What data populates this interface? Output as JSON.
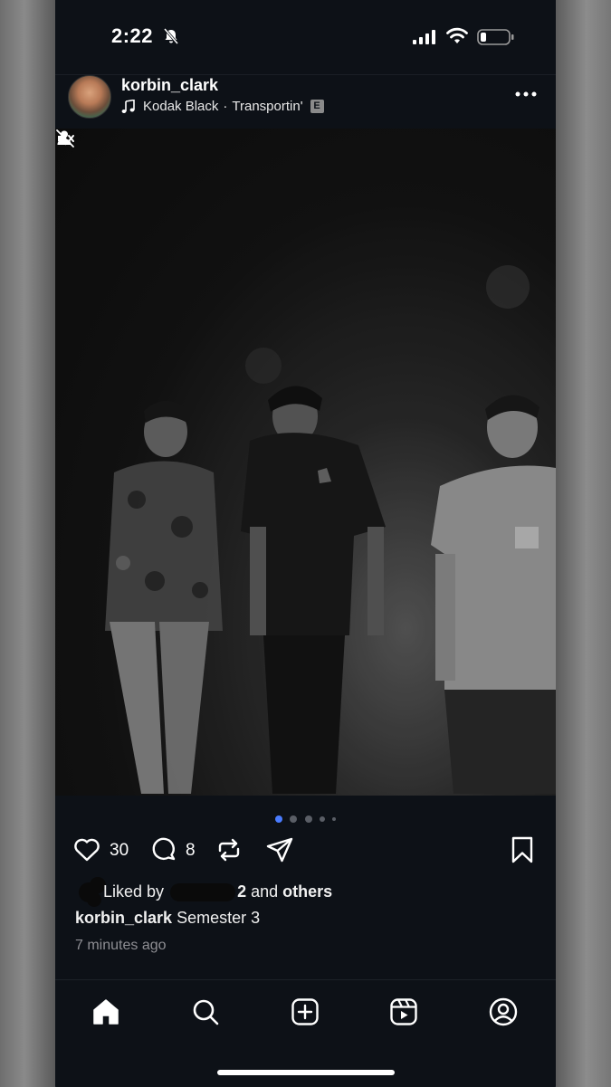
{
  "status_bar": {
    "time": "2:22",
    "icons": [
      "bell-slash-icon",
      "cellular-signal-icon",
      "wifi-icon",
      "battery-icon"
    ]
  },
  "post": {
    "username": "korbin_clark",
    "music": {
      "artist": "Kodak Black",
      "separator": "·",
      "song": "Transportin'",
      "explicit_badge": "E"
    },
    "photo_overlay_icons": [
      "user-tag-icon",
      "sound-off-icon"
    ],
    "carousel": {
      "total_dots": 5,
      "active_index": 0,
      "active_color": "#4a7cff"
    },
    "actions": {
      "likes_count": "30",
      "comments_count": "8"
    },
    "liked_by": {
      "prefix": "Liked by",
      "user_suffix": "2",
      "connector": "and",
      "others": "others"
    },
    "caption": {
      "username": "korbin_clark",
      "text": "Semester 3"
    },
    "timestamp": "7 minutes ago"
  },
  "bottom_nav": {
    "items": [
      "home-icon",
      "search-icon",
      "create-post-icon",
      "reels-icon",
      "profile-icon"
    ]
  }
}
